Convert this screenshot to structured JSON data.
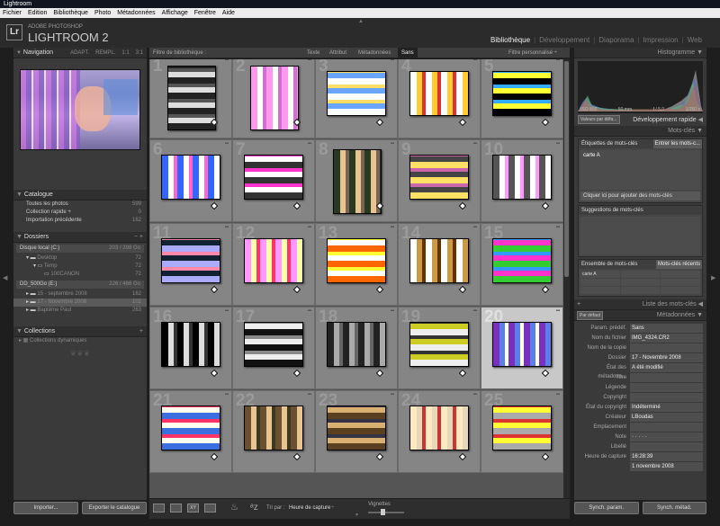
{
  "window": {
    "title": "Lightroom"
  },
  "menu": [
    "Fichier",
    "Edition",
    "Bibliothèque",
    "Photo",
    "Métadonnées",
    "Affichage",
    "Fenêtre",
    "Aide"
  ],
  "identity": {
    "logo": "Lr",
    "line1": "ADOBE PHOTOSHOP",
    "line2": "LIGHTROOM 2"
  },
  "modules": [
    {
      "label": "Bibliothèque",
      "active": true
    },
    {
      "label": "Développement"
    },
    {
      "label": "Diaporama"
    },
    {
      "label": "Impression"
    },
    {
      "label": "Web"
    }
  ],
  "navigator": {
    "title": "Navigation",
    "modes": [
      "ADAPT.",
      "REMPL.",
      "1:1",
      "3:1"
    ]
  },
  "catalog": {
    "title": "Catalogue",
    "items": [
      {
        "label": "Toutes les photos",
        "count": "599"
      },
      {
        "label": "Collection rapide +",
        "count": "0"
      },
      {
        "label": "Importation précédente",
        "count": "162"
      }
    ]
  },
  "folders": {
    "title": "Dossiers",
    "drive1": {
      "label": "Disque local (C:)",
      "info": "203 / 298 Go"
    },
    "items1": [
      {
        "label": "Desktop",
        "count": "72"
      },
      {
        "label": "Temp",
        "count": "72"
      },
      {
        "label": "100CANON",
        "count": "72"
      }
    ],
    "drive2": {
      "label": "DD_500Go (E:)",
      "info": "226 / 466 Go"
    },
    "items2": [
      {
        "label": "15 - septembre 2008",
        "count": "162"
      },
      {
        "label": "17 - Novembre 2008",
        "count": "102"
      },
      {
        "label": "Baptême Paul",
        "count": "263"
      }
    ]
  },
  "collections": {
    "title": "Collections",
    "items": [
      {
        "label": "Collections dynamiques"
      }
    ]
  },
  "left_buttons": {
    "import": "Importer...",
    "export": "Exporter le catalogue"
  },
  "filter": {
    "label": "Filtre de bibliothèque :",
    "options": [
      "Texte",
      "Attribut",
      "Métadonnées",
      "Sans"
    ],
    "preset": "Filtre personnalisé ÷"
  },
  "grid": {
    "numbers": [
      "1",
      "2",
      "3",
      "4",
      "5",
      "6",
      "7",
      "8",
      "9",
      "10",
      "11",
      "12",
      "13",
      "14",
      "15",
      "16",
      "17",
      "18",
      "19",
      "20",
      "21",
      "22",
      "23",
      "24",
      "25"
    ]
  },
  "toolbar": {
    "sort_label": "Tri par :",
    "sort_value": "Heure de capture",
    "thumbs": "Vignettes"
  },
  "right": {
    "histogram": {
      "title": "Histogramme",
      "iso": "ISO 800",
      "focal": "50 mm",
      "aperture": "f / 5,0",
      "speed": "1/250 s"
    },
    "quick_dev": {
      "title": "Développement rapide",
      "preset": "Valeurs par défa..."
    },
    "keywords": {
      "title": "Mots-clés",
      "tags_label": "Étiquettes de mots-clés",
      "tags_mode": "Entrer les mots-c...",
      "tag": "carte A",
      "click_add": "Cliquer ici pour ajouter des mots-clés",
      "suggestions": "Suggestions de mots-clés",
      "set_label": "Ensemble de mots-clés",
      "set_value": "Mots-clés récents",
      "set_grid": [
        "carte A",
        "",
        "",
        "",
        "",
        "",
        "",
        "",
        "",
        ""
      ]
    },
    "kw_list": {
      "title": "Liste des mots-clés"
    },
    "metadata": {
      "title": "Métadonnées",
      "default": "Par défaut",
      "preset_label": "Param. prédéf.",
      "preset_value": "Sans",
      "fields": [
        {
          "k": "Nom du fichier",
          "v": "IMG_4324.CR2"
        },
        {
          "k": "Nom de la copie",
          "v": ""
        },
        {
          "k": "Dossier",
          "v": "17 - Novembre 2008"
        },
        {
          "k": "État des métadonn...",
          "v": "A été modifié"
        },
        {
          "k": "Titre",
          "v": ""
        },
        {
          "k": "Légende",
          "v": ""
        },
        {
          "k": "Copyright",
          "v": ""
        },
        {
          "k": "État du copyright",
          "v": "Indéterminé"
        },
        {
          "k": "Créateur",
          "v": "LBoudas"
        },
        {
          "k": "Emplacement",
          "v": ""
        },
        {
          "k": "Note",
          "v": "· · · · ·"
        },
        {
          "k": "Libellé",
          "v": ""
        },
        {
          "k": "Heure de capture",
          "v": "16:28:39"
        },
        {
          "k": "",
          "v": "1 novembre 2008"
        }
      ]
    },
    "buttons": {
      "sync_params": "Synch. param.",
      "sync_meta": "Synch. métad."
    }
  },
  "colors": {
    "accent": "#c8c8c8",
    "panel": "#3a3a3a"
  }
}
